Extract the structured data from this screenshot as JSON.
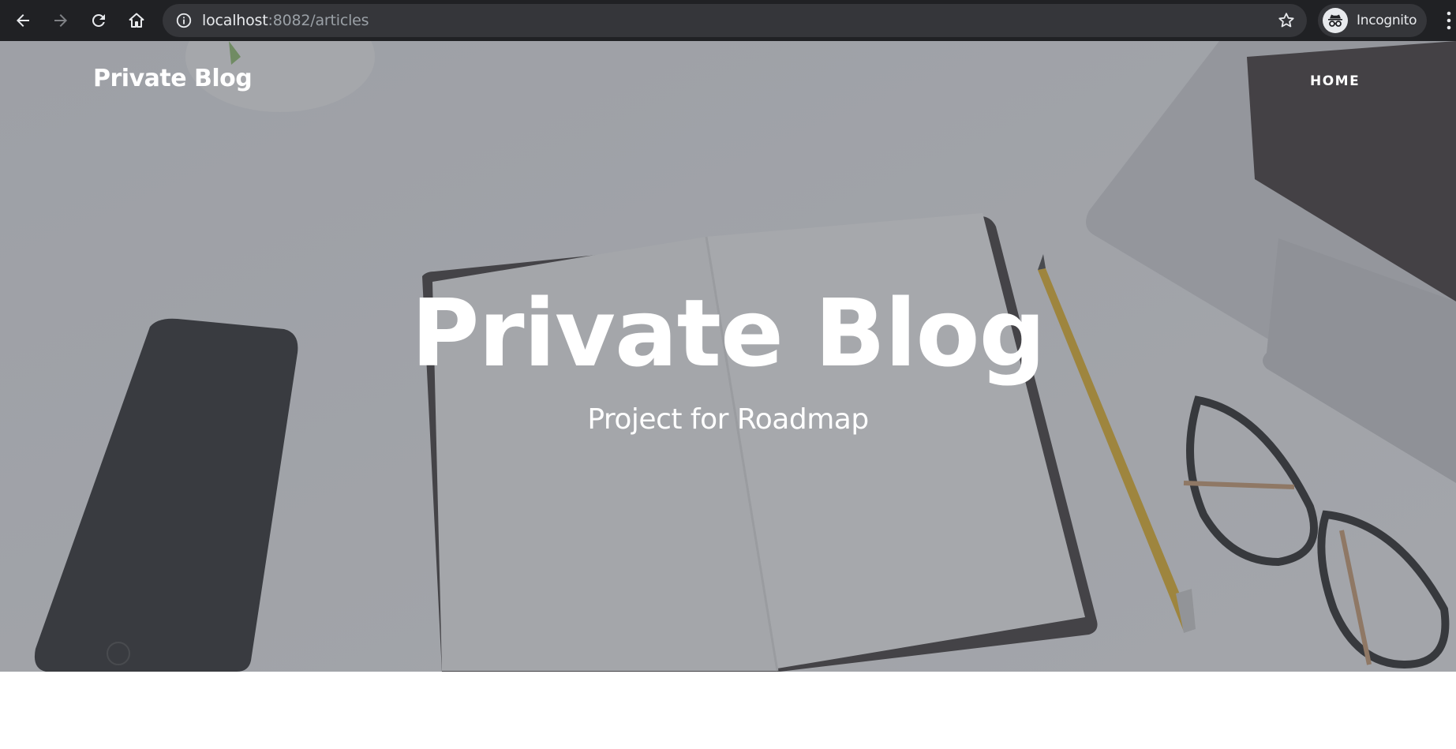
{
  "browser": {
    "url_host": "localhost",
    "url_rest": ":8082/articles",
    "incognito_label": "Incognito",
    "icons": [
      "back-icon",
      "forward-icon",
      "reload-icon",
      "home-icon",
      "info-icon",
      "star-icon",
      "incognito-icon",
      "menu-icon"
    ]
  },
  "site": {
    "brand": "Private Blog",
    "nav": [
      {
        "label": "HOME"
      }
    ]
  },
  "hero": {
    "heading": "Private Blog",
    "subheading": "Project for Roadmap"
  },
  "colors": {
    "chrome_bg": "#202124",
    "omnibox_bg": "#35363a",
    "text_light": "#e8eaed",
    "text_dim": "#9aa0a6",
    "hero_overlay": "#50535c"
  }
}
